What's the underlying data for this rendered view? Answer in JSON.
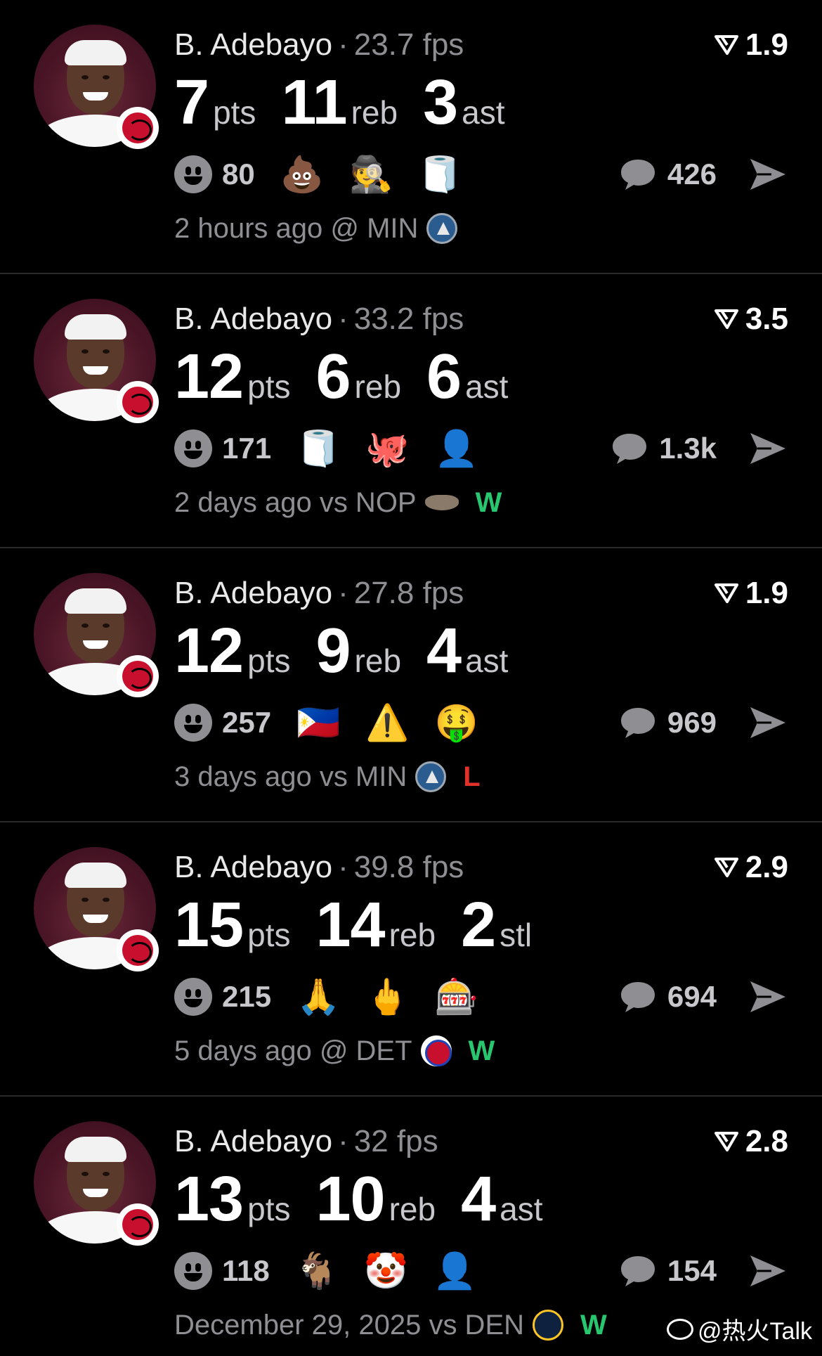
{
  "accent": {
    "win": "#28c76f",
    "loss": "#e0312b",
    "muted": "#8e8e93"
  },
  "cards": [
    {
      "player": "B. Adebayo",
      "sep": "·",
      "fps": "23.7 fps",
      "rating": "1.9",
      "stats": [
        {
          "num": "7",
          "unit": "pts"
        },
        {
          "num": "11",
          "unit": "reb"
        },
        {
          "num": "3",
          "unit": "ast"
        }
      ],
      "reaction_count": "80",
      "emojis": [
        "💩",
        "🕵",
        "🧻"
      ],
      "comment_count": "426",
      "meta": "2 hours ago @ MIN",
      "opponent_logo": "min-logo-icon",
      "result": ""
    },
    {
      "player": "B. Adebayo",
      "sep": "·",
      "fps": "33.2 fps",
      "rating": "3.5",
      "stats": [
        {
          "num": "12",
          "unit": "pts"
        },
        {
          "num": "6",
          "unit": "reb"
        },
        {
          "num": "6",
          "unit": "ast"
        }
      ],
      "reaction_count": "171",
      "emojis": [
        "🧻",
        "🐙",
        "👤"
      ],
      "comment_count": "1.3k",
      "meta": "2 days ago vs NOP",
      "opponent_logo": "nop-logo-icon",
      "result": "W"
    },
    {
      "player": "B. Adebayo",
      "sep": "·",
      "fps": "27.8 fps",
      "rating": "1.9",
      "stats": [
        {
          "num": "12",
          "unit": "pts"
        },
        {
          "num": "9",
          "unit": "reb"
        },
        {
          "num": "4",
          "unit": "ast"
        }
      ],
      "reaction_count": "257",
      "emojis": [
        "🇵🇭",
        "⚠️",
        "🤑"
      ],
      "comment_count": "969",
      "meta": "3 days ago vs MIN",
      "opponent_logo": "min-logo-icon",
      "result": "L"
    },
    {
      "player": "B. Adebayo",
      "sep": "·",
      "fps": "39.8 fps",
      "rating": "2.9",
      "stats": [
        {
          "num": "15",
          "unit": "pts"
        },
        {
          "num": "14",
          "unit": "reb"
        },
        {
          "num": "2",
          "unit": "stl"
        }
      ],
      "reaction_count": "215",
      "emojis": [
        "🙏",
        "🖕",
        "🎰"
      ],
      "comment_count": "694",
      "meta": "5 days ago @ DET",
      "opponent_logo": "det-logo-icon",
      "result": "W"
    },
    {
      "player": "B. Adebayo",
      "sep": "·",
      "fps": "32 fps",
      "rating": "2.8",
      "stats": [
        {
          "num": "13",
          "unit": "pts"
        },
        {
          "num": "10",
          "unit": "reb"
        },
        {
          "num": "4",
          "unit": "ast"
        }
      ],
      "reaction_count": "118",
      "emojis": [
        "🐐",
        "🤡",
        "👤"
      ],
      "comment_count": "154",
      "meta": "December 29, 2025 vs DEN",
      "opponent_logo": "den-logo-icon",
      "result": "W"
    }
  ],
  "watermark": "@热火Talk"
}
